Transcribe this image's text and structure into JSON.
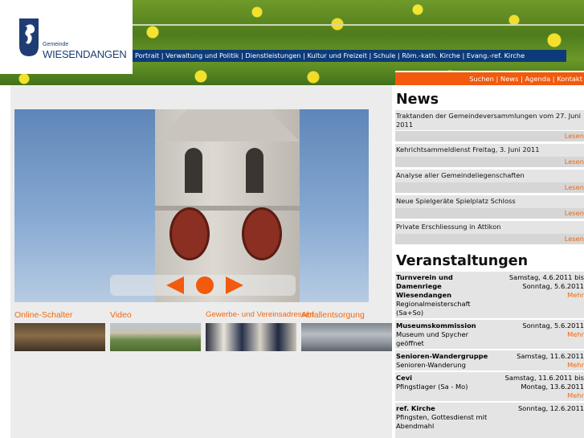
{
  "brand": {
    "small": "Gemeinde",
    "big": "WIESENDANGEN"
  },
  "topnav": [
    "Portrait",
    "Verwaltung und Politik",
    "Dienstleistungen",
    "Kultur und Freizeit",
    "Schule",
    "Röm.-kath. Kirche",
    "Evang.-ref. Kirche"
  ],
  "utility": [
    "Suchen",
    "News",
    "Agenda",
    "Kontakt"
  ],
  "tiles": [
    "Online-Schalter",
    "Video",
    "Gewerbe- und Vereinsadressen",
    "Abfallentsorgung"
  ],
  "news": {
    "title": "News",
    "read_label": "Lesen",
    "items": [
      "Traktanden der Gemeindeversammlungen vom 27. Juni 2011",
      "Kehrichtsammeldienst Freitag, 3. Juni 2011",
      "Analyse aller Gemeindeliegenschaften",
      "Neue Spielgeräte Spielplatz Schloss",
      "Private Erschliessung in Attikon"
    ]
  },
  "events": {
    "title": "Veranstaltungen",
    "more_label": "Mehr",
    "items": [
      {
        "org": "Turnverein und Damenriege Wiesendangen",
        "desc": "Regionalmeisterschaft (Sa+So)",
        "date": "Samstag, 4.6.2011 bis Sonntag, 5.6.2011"
      },
      {
        "org": "Museumskommission",
        "desc": "Museum und Spycher geöffnet",
        "date": "Sonntag, 5.6.2011"
      },
      {
        "org": "Senioren-Wandergruppe",
        "desc": "Senioren-Wanderung",
        "date": "Samstag, 11.6.2011"
      },
      {
        "org": "Cevi",
        "desc": "Pfingstlager (Sa - Mo)",
        "date": "Samstag, 11.6.2011 bis Montag, 13.6.2011"
      },
      {
        "org": "ref. Kirche",
        "desc": "Pfingsten, Gottesdienst mit Abendmahl",
        "date": "Sonntag, 12.6.2011"
      }
    ]
  },
  "colors": {
    "nav": "#0d3b7a",
    "accent": "#f25a0d"
  }
}
